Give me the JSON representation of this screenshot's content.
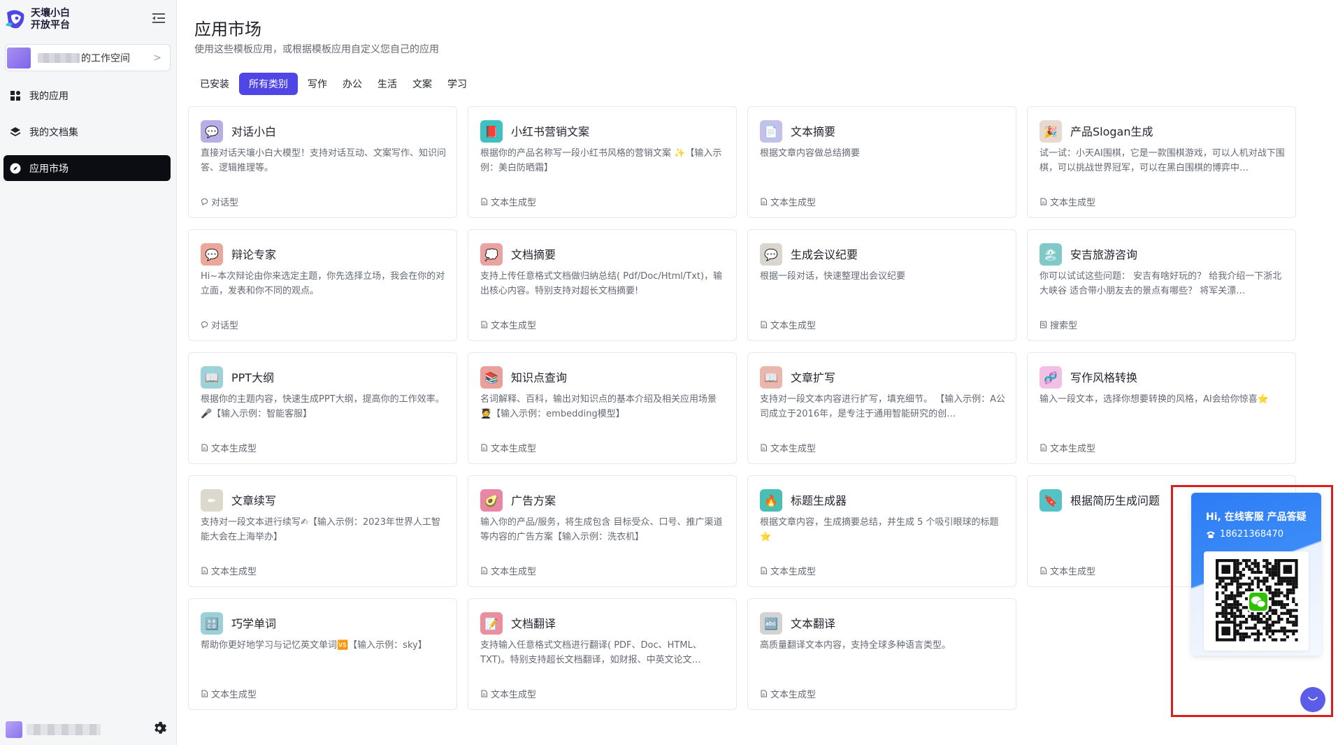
{
  "brand": {
    "line1": "天壤小白",
    "line2": "开放平台"
  },
  "workspace": {
    "name": "的工作空间",
    "chevron": ">"
  },
  "nav": [
    {
      "label": "我的应用",
      "icon": "grid-icon"
    },
    {
      "label": "我的文档集",
      "icon": "layers-icon"
    },
    {
      "label": "应用市场",
      "icon": "compass-icon",
      "active": true
    }
  ],
  "header": {
    "title": "应用市场",
    "subtitle": "使用这些模板应用，或根据模板应用自定义您自己的应用"
  },
  "tabs": [
    {
      "label": "已安装"
    },
    {
      "label": "所有类别",
      "active": true
    },
    {
      "label": "写作"
    },
    {
      "label": "办公"
    },
    {
      "label": "生活"
    },
    {
      "label": "文案"
    },
    {
      "label": "学习"
    }
  ],
  "colors": {
    "accent": "#4f46e5",
    "active_nav": "#0c0d12",
    "highlight": "#e01b1b",
    "support_blue": "#2d7cf6"
  },
  "apps": [
    {
      "title": "对话小白",
      "desc": "直接对话天壤小白大模型！支持对话互动、文案写作、知识问答、逻辑推理等。",
      "type": "对话型",
      "type_icon": "chat-bubble-icon",
      "icon": "💬",
      "icon_name": "chat-icon",
      "icon_bg": "#b7aee8"
    },
    {
      "title": "小红书营销文案",
      "desc": "根据你的产品名称写一段小红书风格的营销文案 ✨【输入示例：美白防晒霜】",
      "type": "文本生成型",
      "type_icon": "document-icon",
      "icon": "📕",
      "icon_name": "red-book-icon",
      "icon_bg": "#3ec1c1"
    },
    {
      "title": "文本摘要",
      "desc": "根据文章内容做总结摘要",
      "type": "文本生成型",
      "type_icon": "document-icon",
      "icon": "📄",
      "icon_name": "page-icon",
      "icon_bg": "#c3c0ea"
    },
    {
      "title": "产品Slogan生成",
      "desc": "试一试：小天AI围棋，它是一款围棋游戏，可以人机对战下围棋，可以挑战世界冠军，可以在黑白围棋的博弈中…",
      "type": "文本生成型",
      "type_icon": "document-icon",
      "icon": "🎉",
      "icon_name": "party-popper-icon",
      "icon_bg": "#e7d9cd"
    },
    {
      "title": "辩论专家",
      "desc": "Hi~本次辩论由你来选定主题，你先选择立场，我会在你的对立面，发表和你不同的观点。",
      "type": "对话型",
      "type_icon": "chat-bubble-icon",
      "icon": "💬",
      "icon_name": "speech-icon",
      "icon_bg": "#eaa79a"
    },
    {
      "title": "文档摘要",
      "desc": "支持上传任意格式文档做归纳总结( Pdf/Doc/Html/Txt)，输出核心内容。特别支持对超长文档摘要!",
      "type": "文本生成型",
      "type_icon": "document-icon",
      "icon": "💭",
      "icon_name": "thought-bubble-icon",
      "icon_bg": "#e9a3a0"
    },
    {
      "title": "生成会议纪要",
      "desc": "根据一段对话，快速整理出会议纪要",
      "type": "文本生成型",
      "type_icon": "document-icon",
      "icon": "💬",
      "icon_name": "meeting-icon",
      "icon_bg": "#d9d6d0"
    },
    {
      "title": "安吉旅游咨询",
      "desc": "你可以试试这些问题： 安吉有啥好玩的？ 给我介绍一下浙北大峡谷 适合带小朋友去的景点有哪些？ 将军关漂…",
      "type": "搜索型",
      "type_icon": "search-doc-icon",
      "icon": "🏖",
      "icon_name": "beach-icon",
      "icon_bg": "#7fc9c9"
    },
    {
      "title": "PPT大纲",
      "desc": "根据你的主题内容，快速生成PPT大纲，提高你的工作效率。🎤【输入示例：智能客服】",
      "type": "文本生成型",
      "type_icon": "document-icon",
      "icon": "📖",
      "icon_name": "book-icon",
      "icon_bg": "#9dd3d8"
    },
    {
      "title": "知识点查询",
      "desc": "名词解释、百科，输出对知识点的基本介绍及相关应用场景🧑‍🎓【输入示例：embedding模型】",
      "type": "文本生成型",
      "type_icon": "document-icon",
      "icon": "📚",
      "icon_name": "books-icon",
      "icon_bg": "#ec9f98"
    },
    {
      "title": "文章扩写",
      "desc": "支持对一段文本内容进行扩写，填充细节。 【输入示例：A公司成立于2016年，是专注于通用智能研究的创…",
      "type": "文本生成型",
      "type_icon": "document-icon",
      "icon": "📖",
      "icon_name": "open-book-icon",
      "icon_bg": "#eab7ad"
    },
    {
      "title": "写作风格转换",
      "desc": "输入一段文本，选择你想要转换的风格，AI会给你惊喜⭐",
      "type": "文本生成型",
      "type_icon": "document-icon",
      "icon": "🧬",
      "icon_name": "dna-icon",
      "icon_bg": "#f3bfe2"
    },
    {
      "title": "文章续写",
      "desc": "支持对一段文本进行续写✍【输入示例：2023年世界人工智能大会在上海举办】",
      "type": "文本生成型",
      "type_icon": "document-icon",
      "icon": "✒",
      "icon_name": "pen-icon",
      "icon_bg": "#ddd8cd"
    },
    {
      "title": "广告方案",
      "desc": "输入你的产品/服务，将生成包含 目标受众、口号、推广渠道等内容的广告方案【输入示例：洗衣机】",
      "type": "文本生成型",
      "type_icon": "document-icon",
      "icon": "🥑",
      "icon_name": "avocado-icon",
      "icon_bg": "#ea86a5"
    },
    {
      "title": "标题生成器",
      "desc": "根据文章内容，生成摘要总结，并生成 5 个吸引眼球的标题 ⭐",
      "type": "文本生成型",
      "type_icon": "document-icon",
      "icon": "🔥",
      "icon_name": "fire-icon",
      "icon_bg": "#48bfb2"
    },
    {
      "title": "根据简历生成问题",
      "desc": "",
      "type": "文本生成型",
      "type_icon": "document-icon",
      "icon": "🔖",
      "icon_name": "bookmark-icon",
      "icon_bg": "#53c3c6"
    },
    {
      "title": "巧学单词",
      "desc": "帮助你更好地学习与记忆英文单词🆚【输入示例：sky】",
      "type": "文本生成型",
      "type_icon": "document-icon",
      "icon": "🔠",
      "icon_name": "abc-icon",
      "icon_bg": "#9ad0d6"
    },
    {
      "title": "文档翻译",
      "desc": "支持输入任意格式文档进行翻译( PDF、Doc、HTML、TXT)。特别支持超长文档翻译，如财报、中英文论文…",
      "type": "文本生成型",
      "type_icon": "document-icon",
      "icon": "📝",
      "icon_name": "memo-icon",
      "icon_bg": "#eb8f9a"
    },
    {
      "title": "文本翻译",
      "desc": "高质量翻译文本内容，支持全球多种语言类型。",
      "type": "文本生成型",
      "type_icon": "document-icon",
      "icon": "🔤",
      "icon_name": "translate-icon",
      "icon_bg": "#d3d3d3"
    }
  ],
  "support": {
    "title": "Hi, 在线客服 产品答疑",
    "phone": "18621368470"
  }
}
